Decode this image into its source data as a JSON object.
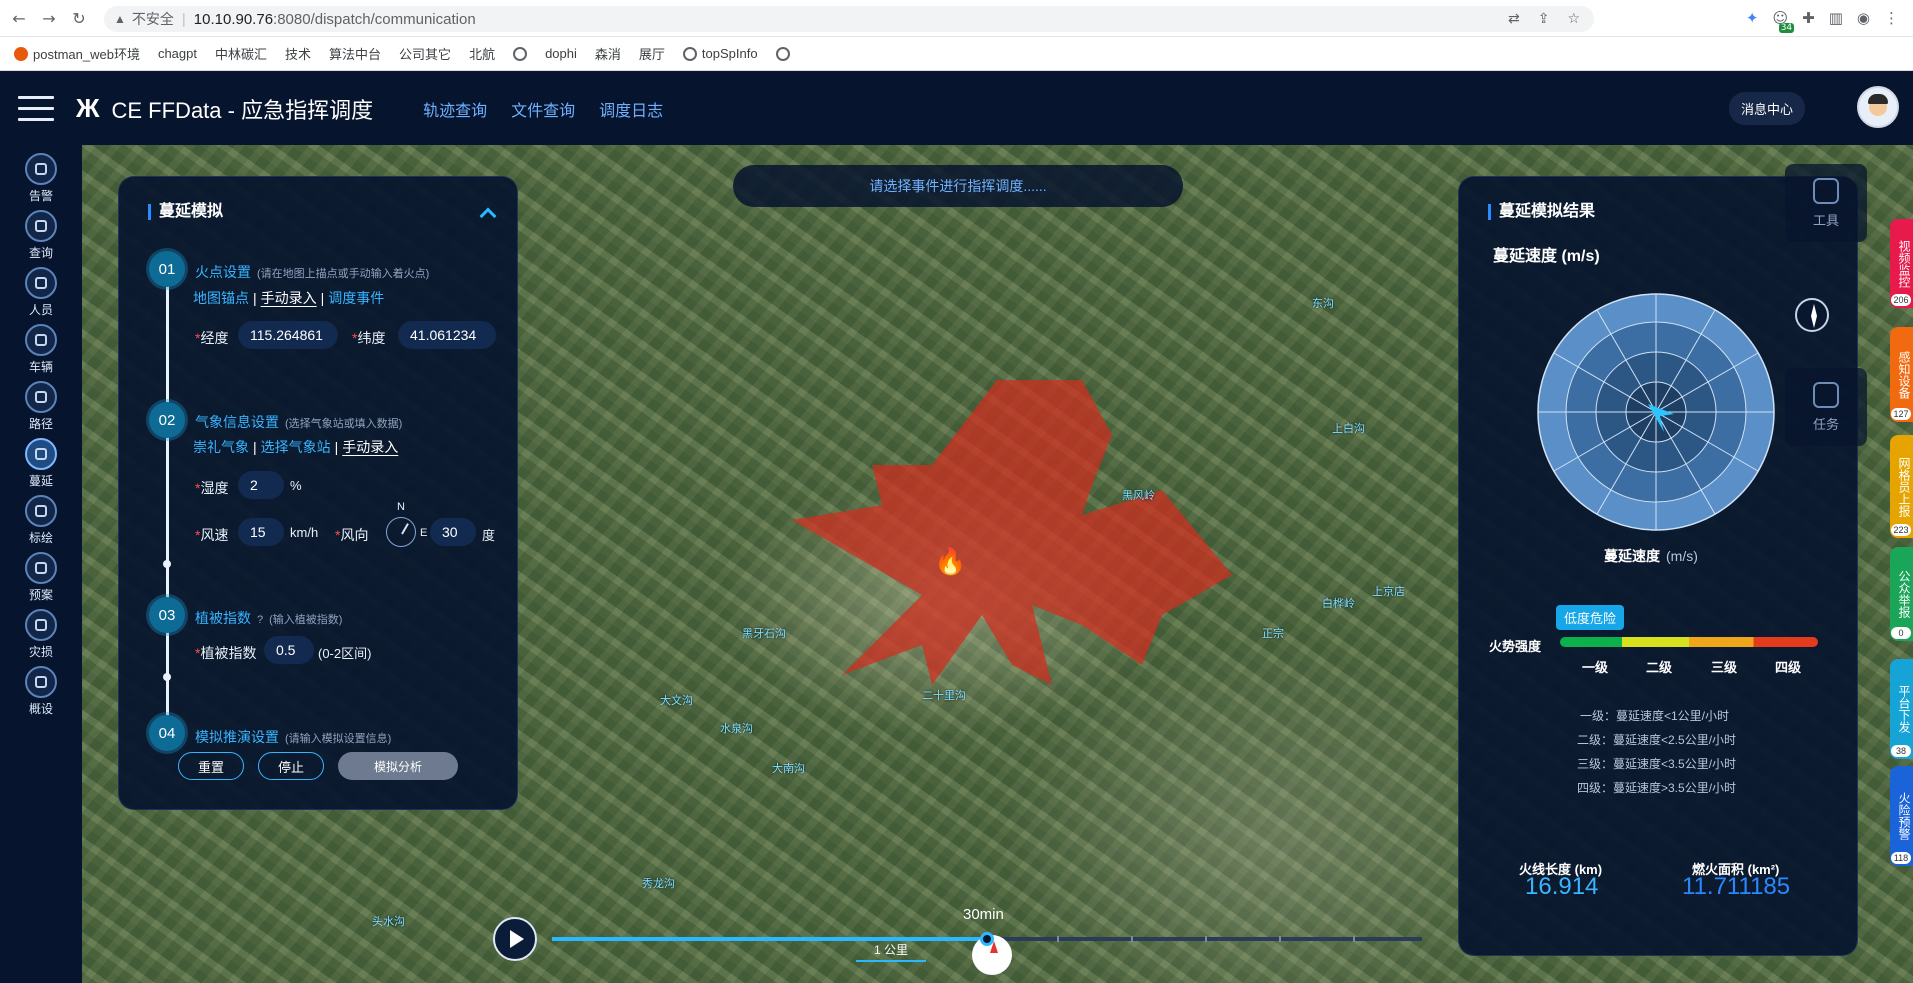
{
  "browser": {
    "security_label": "不安全",
    "url_host": "10.10.90.76",
    "url_rest": ":8080/dispatch/communication",
    "ext_badge": "34",
    "bookmarks": [
      "postman_web环境",
      "chagpt",
      "中林碳汇",
      "技术",
      "算法中台",
      "公司其它",
      "北航",
      "dophi",
      "森消",
      "展厅",
      "topSpInfo"
    ]
  },
  "header": {
    "logo": "Ж",
    "title": "CE FFData - 应急指挥调度",
    "nav": [
      "轨迹查询",
      "文件查询",
      "调度日志"
    ],
    "message_center": "消息中心"
  },
  "rail": [
    "告警",
    "查询",
    "人员",
    "车辆",
    "路径",
    "蔓延",
    "标绘",
    "预案",
    "灾损",
    "概设"
  ],
  "event_bar": "请选择事件进行指挥调度......",
  "left_panel": {
    "title": "蔓延模拟",
    "steps": [
      {
        "num": "01",
        "title": "火点设置",
        "hint": "(请在地图上描点或手动输入着火点)"
      },
      {
        "num": "02",
        "title": "气象信息设置",
        "hint": "(选择气象站或填入数据)"
      },
      {
        "num": "03",
        "title": "植被指数",
        "hint": "(输入植被指数)"
      },
      {
        "num": "04",
        "title": "模拟推演设置",
        "hint": "(请输入模拟设置信息)"
      }
    ],
    "step1_opts": [
      "地图锚点",
      "手动录入",
      "调度事件"
    ],
    "step2_opts": [
      "崇礼气象",
      "选择气象站",
      "手动录入"
    ],
    "lng_label": "经度",
    "lng": "115.264861",
    "lat_label": "纬度",
    "lat": "41.061234",
    "humidity_label": "湿度",
    "humidity": "2",
    "humidity_unit": "%",
    "wind_speed_label": "风速",
    "wind_speed": "15",
    "wind_speed_unit": "km/h",
    "wind_dir_label": "风向",
    "wind_dir": "30",
    "wind_dir_unit": "度",
    "compass_n": "N",
    "compass_e": "E",
    "veg_label": "植被指数",
    "veg": "0.5",
    "veg_range": "(0-2区间)",
    "btn_reset": "重置",
    "btn_stop": "停止",
    "btn_analyze": "模拟分析"
  },
  "right_panel": {
    "title": "蔓延模拟结果",
    "speed_title": "蔓延速度 (m/s)",
    "radar_caption": "蔓延速度",
    "radar_unit": "(m/s)",
    "risk_badge": "低度危险",
    "intensity_label": "火势强度",
    "levels": [
      "一级",
      "二级",
      "三级",
      "四级"
    ],
    "legend": [
      "一级：蔓延速度<1公里/小时",
      "二级：蔓延速度<2.5公里/小时",
      "三级：蔓延速度<3.5公里/小时",
      "四级：蔓延速度>3.5公里/小时"
    ],
    "fire_line_label": "火线长度 (km)",
    "fire_line": "16.914",
    "burn_area_label": "燃火面积 (km²)",
    "burn_area": "11.711185"
  },
  "tools": [
    "工具",
    "",
    "任务"
  ],
  "side_tabs": [
    {
      "label": "视频监控",
      "count": "206",
      "color": "#e8194b"
    },
    {
      "label": "感知设备",
      "count": "127",
      "color": "#f26a0f"
    },
    {
      "label": "网格员上报",
      "count": "223",
      "color": "#e6a400"
    },
    {
      "label": "公众举报",
      "count": "0",
      "color": "#1aa558"
    },
    {
      "label": "平台下发",
      "count": "38",
      "color": "#16a4d6"
    },
    {
      "label": "火险预警",
      "count": "118",
      "color": "#1a63d8"
    }
  ],
  "timeline": {
    "time": "30min",
    "scale": "1 公里"
  },
  "map_labels": [
    "二十里沟",
    "黑牙石沟",
    "大文沟",
    "水泉沟",
    "上京店",
    "白桦岭",
    "东沟",
    "黑风岭",
    "正宗",
    "上白沟",
    "大南沟",
    "秀龙沟",
    "头水沟"
  ]
}
